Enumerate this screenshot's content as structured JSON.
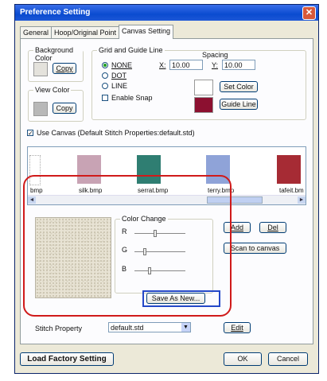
{
  "window": {
    "title": "Preference Setting",
    "close_glyph": "✕"
  },
  "tabs": [
    {
      "label": "General"
    },
    {
      "label": "Hoop/Original Point"
    },
    {
      "label": "Canvas Setting"
    }
  ],
  "background_color": {
    "legend": "Background Color",
    "copy_label": "Copy",
    "swatch_color": "#e4e2dc"
  },
  "view_color": {
    "legend": "View Color",
    "copy_label": "Copy",
    "swatch_color": "#b8b8b8"
  },
  "grid": {
    "legend": "Grid and Guide Line",
    "options": [
      {
        "label": "NONE",
        "selected": true
      },
      {
        "label": "DOT",
        "selected": false
      },
      {
        "label": "LINE",
        "selected": false
      }
    ],
    "enable_snap_label": "Enable Snap",
    "spacing_label": "Spacing",
    "x_label": "X:",
    "x_value": "10.00",
    "y_label": "Y:",
    "y_value": "10.00",
    "set_color_label": "Set Color",
    "guide_line_label": "Guide Line",
    "grid_color": "#ffffff",
    "guide_color": "#8c1030"
  },
  "canvas": {
    "use_canvas_label": "Use Canvas (Default Stitch Properties:default.std)",
    "use_canvas_checked": true,
    "files": [
      {
        "name": "bmp",
        "color": "#ffffff"
      },
      {
        "name": "silk.bmp",
        "color": "#c8a3b4"
      },
      {
        "name": "serrat.bmp",
        "color": "#2f7e72"
      },
      {
        "name": "terry.bmp",
        "color": "#8fa3d8"
      },
      {
        "name": "tafeit.bm",
        "color": "#a62b34"
      }
    ],
    "scroll_left": "◄",
    "scroll_right": "►",
    "add_label": "Add",
    "del_label": "Del",
    "scan_label": "Scan to canvas"
  },
  "color_change": {
    "legend": "Color Change",
    "r_label": "R",
    "g_label": "G",
    "b_label": "B",
    "r_level": 0.4,
    "g_level": 0.2,
    "b_level": 0.3,
    "save_as_new_label": "Save As New..."
  },
  "stitch": {
    "label": "Stitch Property",
    "value": "default.std",
    "dropdown_glyph": "▼",
    "edit_label": "Edit"
  },
  "footer": {
    "load_factory_label": "Load Factory Setting",
    "ok_label": "OK",
    "cancel_label": "Cancel"
  },
  "annotation_colors": {
    "red": "#d01a1a",
    "blue": "#2448c8"
  }
}
